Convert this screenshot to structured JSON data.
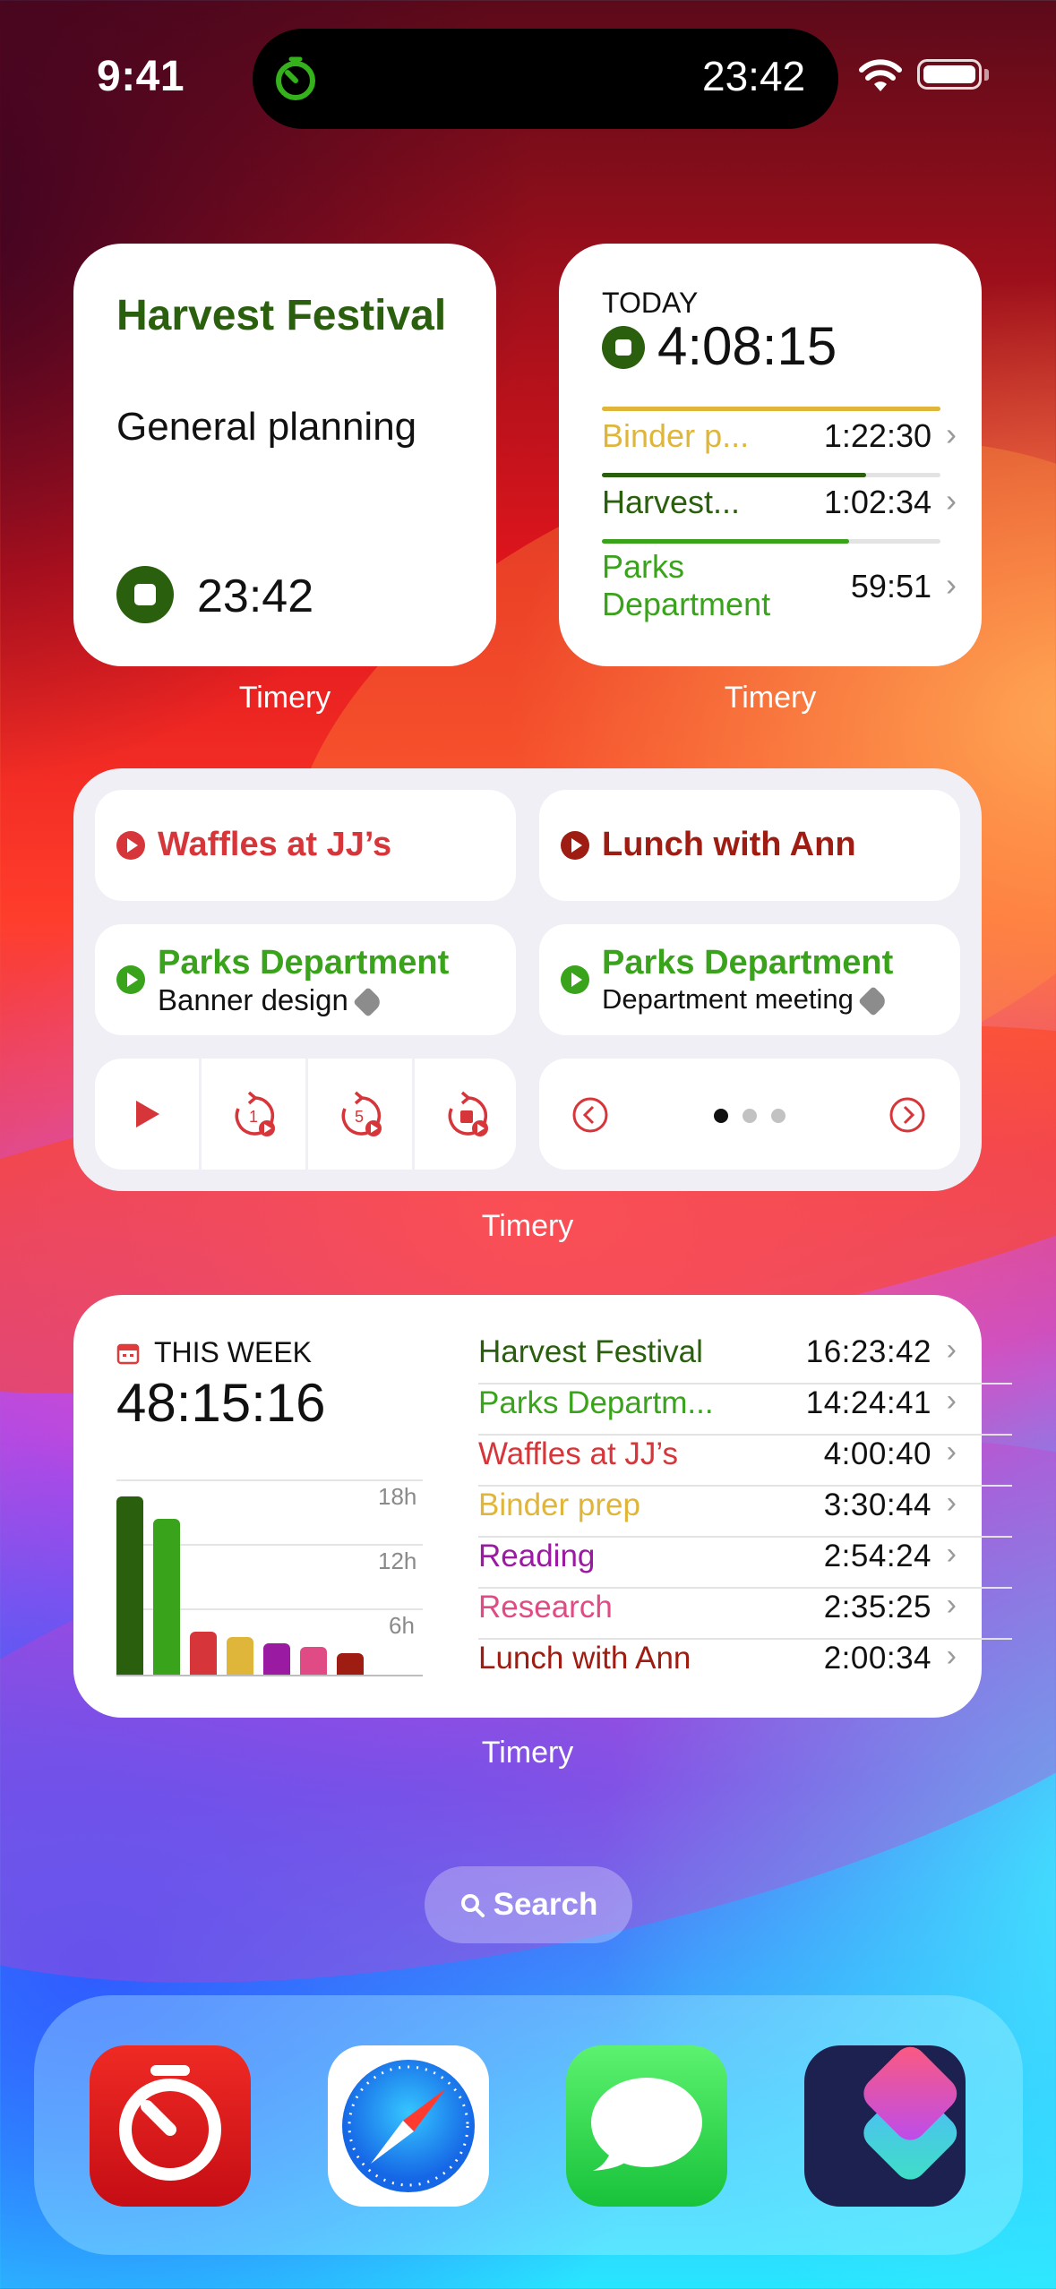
{
  "status": {
    "time": "9:41",
    "live_activity_time": "23:42"
  },
  "widget_running": {
    "project": "Harvest Festival",
    "description": "General planning",
    "elapsed": "23:42",
    "app_label": "Timery"
  },
  "widget_today": {
    "heading": "TODAY",
    "total": "4:08:15",
    "rows": [
      {
        "name": "Binder p...",
        "time": "1:22:30",
        "color": "#e0b63a",
        "fill": 1.0
      },
      {
        "name": "Harvest...",
        "time": "1:02:34",
        "color": "#2a5f0e",
        "fill": 0.78
      },
      {
        "name": "Parks Department",
        "time": "59:51",
        "color": "#3aa31c",
        "fill": 0.73
      }
    ],
    "app_label": "Timery"
  },
  "widget_saved": {
    "tiles": [
      {
        "title": "Waffles at JJ’s",
        "color": "#d6363a"
      },
      {
        "title": "Lunch with Ann",
        "color": "#9e1c12"
      },
      {
        "title": "Parks Department",
        "subtitle": "Banner design",
        "color": "#3aa31c"
      },
      {
        "title": "Parks Department",
        "subtitle": "Department meeting",
        "color": "#3aa31c"
      }
    ],
    "controls": [
      "play-icon",
      "restart-1-icon",
      "restart-5-icon",
      "stop-restart-icon"
    ],
    "pager": {
      "pages": 3,
      "current": 1
    },
    "app_label": "Timery"
  },
  "widget_week": {
    "heading": "THIS WEEK",
    "total": "48:15:16",
    "grid_labels": [
      "18h",
      "12h",
      "6h"
    ],
    "rows": [
      {
        "name": "Harvest Festival",
        "time": "16:23:42",
        "color": "#2a5f0e",
        "hours": 16.4
      },
      {
        "name": "Parks Departm...",
        "time": "14:24:41",
        "color": "#3aa31c",
        "hours": 14.4
      },
      {
        "name": "Waffles at JJ’s",
        "time": "4:00:40",
        "color": "#d6363a",
        "hours": 4.0
      },
      {
        "name": "Binder prep",
        "time": "3:30:44",
        "color": "#e0b63a",
        "hours": 3.5
      },
      {
        "name": "Reading",
        "time": "2:54:24",
        "color": "#9b1aa2",
        "hours": 2.9
      },
      {
        "name": "Research",
        "time": "2:35:25",
        "color": "#e04b86",
        "hours": 2.6
      },
      {
        "name": "Lunch with Ann",
        "time": "2:00:34",
        "color": "#9e1c12",
        "hours": 2.0
      }
    ],
    "app_label": "Timery"
  },
  "search": {
    "label": "Search"
  },
  "dock": [
    "timery-app-icon",
    "safari-app-icon",
    "messages-app-icon",
    "shortcuts-app-icon"
  ]
}
